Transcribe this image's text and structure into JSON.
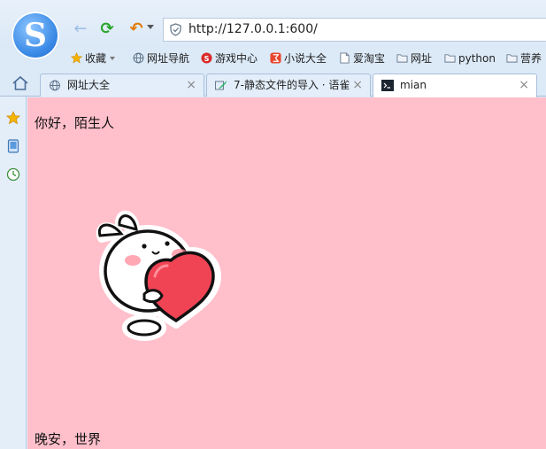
{
  "browser": {
    "url": "http://127.0.0.1:600/",
    "bookmarks": [
      {
        "label": "收藏",
        "icon": "star-icon"
      },
      {
        "label": "网址导航",
        "icon": "globe-icon"
      },
      {
        "label": "游戏中心",
        "icon": "game-icon"
      },
      {
        "label": "小说大全",
        "icon": "book-icon"
      },
      {
        "label": "爱淘宝",
        "icon": "page-icon"
      },
      {
        "label": "网址",
        "icon": "folder-icon"
      },
      {
        "label": "python",
        "icon": "folder-icon"
      },
      {
        "label": "营养",
        "icon": "folder-icon"
      }
    ],
    "tabs": [
      {
        "label": "网址大全",
        "close": "×"
      },
      {
        "label": "7-静态文件的导入 · 语雀",
        "close": "×"
      },
      {
        "label": "mian",
        "close": "×"
      }
    ]
  },
  "page": {
    "greeting": "你好，陌生人",
    "farewell": "晚安，世界"
  },
  "colors": {
    "page_background": "#ffc0cb",
    "accent": "#3a8ae6"
  }
}
